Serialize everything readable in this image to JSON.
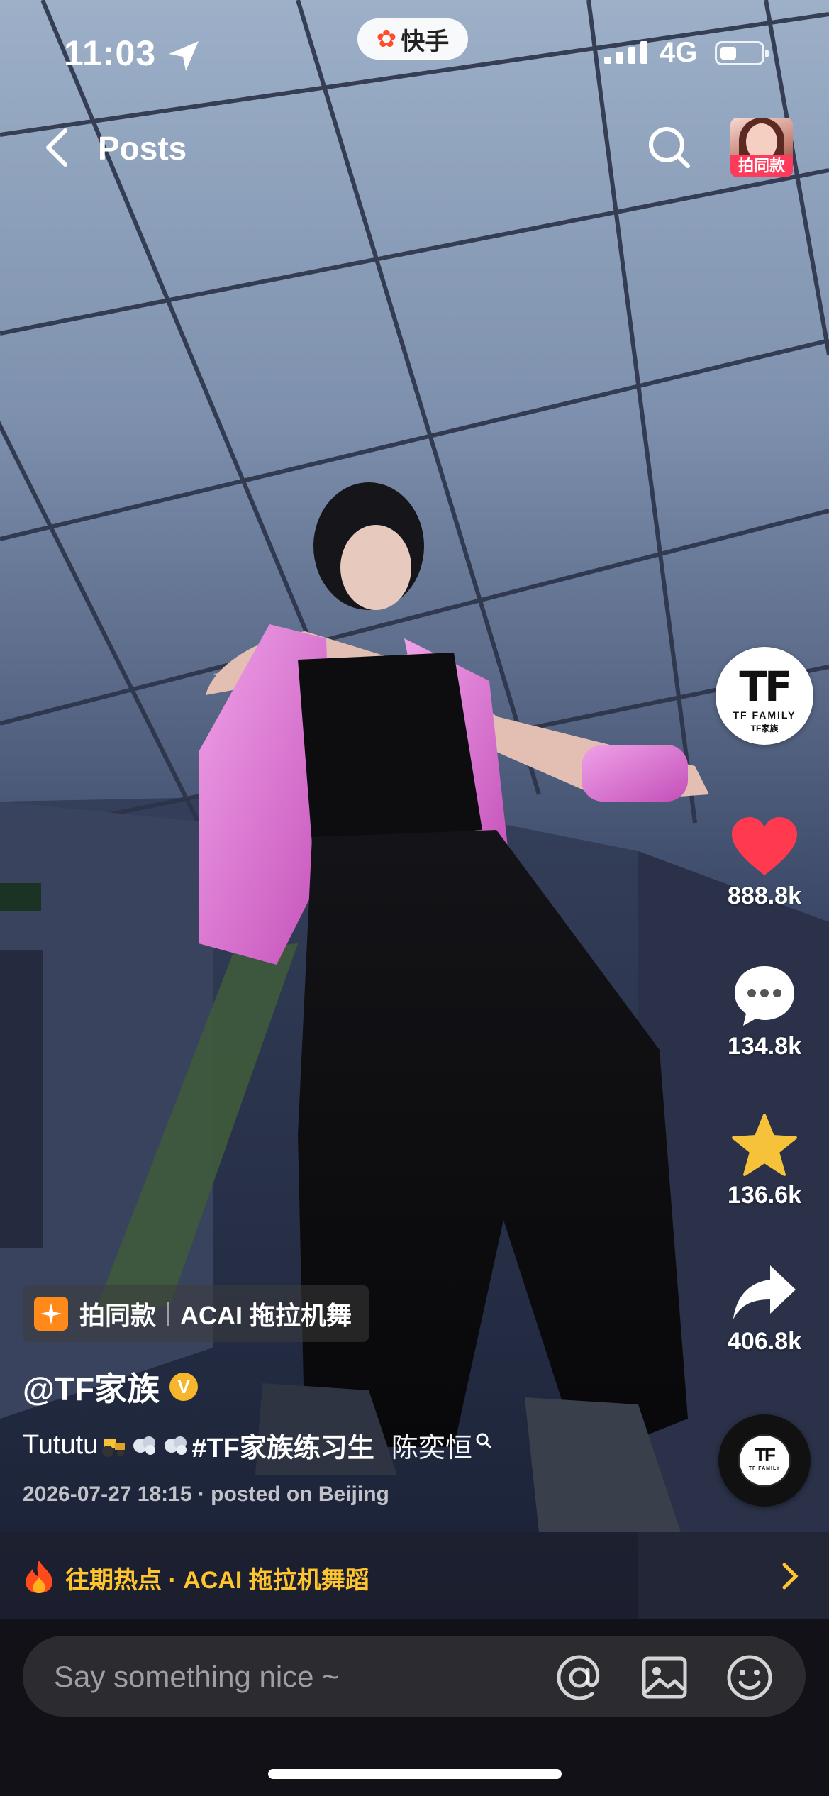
{
  "status_bar": {
    "time": "11:03",
    "network": "4G",
    "app_badge": "快手"
  },
  "header": {
    "back_icon": "chevron-left-icon",
    "title": "Posts",
    "search_icon": "search-icon",
    "same_style_label": "拍同款"
  },
  "creator": {
    "avatar_mark": "TF",
    "avatar_line1": "TF FAMILY",
    "avatar_line2": "TF家族"
  },
  "actions": {
    "like_count": "888.8k",
    "comment_count": "134.8k",
    "favorite_count": "136.6k",
    "share_count": "406.8k",
    "like_color": "#ff3a4e",
    "favorite_color": "#f6c23a"
  },
  "music": {
    "disc_mark": "TF",
    "disc_line": "TF FAMILY"
  },
  "same_chip": {
    "label": "拍同款",
    "template": "ACAI 拖拉机舞"
  },
  "post": {
    "author": "@TF家族",
    "verified_badge": "V",
    "caption_prefix": "Tututu",
    "caption_hashtag": "#TF家族练习生",
    "caption_mention": "陈奕恒",
    "meta": "2026-07-27 18:15 · posted on Beijing"
  },
  "hot_topic": {
    "text": "往期热点 · ACAI 拖拉机舞蹈"
  },
  "comment_bar": {
    "placeholder": "Say something nice ~"
  }
}
